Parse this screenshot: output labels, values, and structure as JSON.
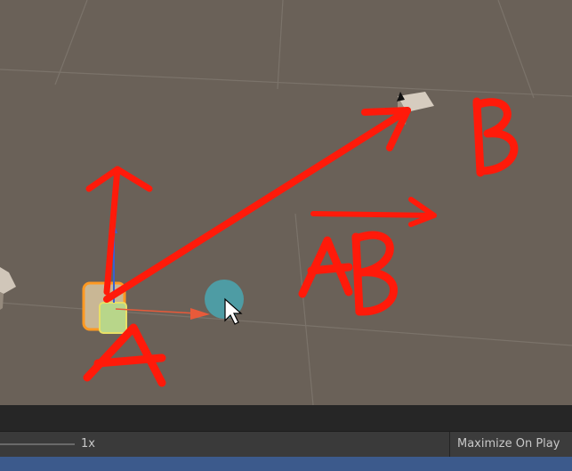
{
  "scene": {
    "annotations": {
      "point_a": "A",
      "point_b": "B",
      "vector": "AB"
    }
  },
  "toolbar": {
    "timescale_label": "1x",
    "maximize_label": "Maximize On Play"
  },
  "colors": {
    "annotation": "#ff1a0a",
    "scene_background": "#6a6158",
    "grid_line": "#7b736a",
    "selection_outline": "#ff9922",
    "gizmo_teal": "#4ba3ad"
  }
}
